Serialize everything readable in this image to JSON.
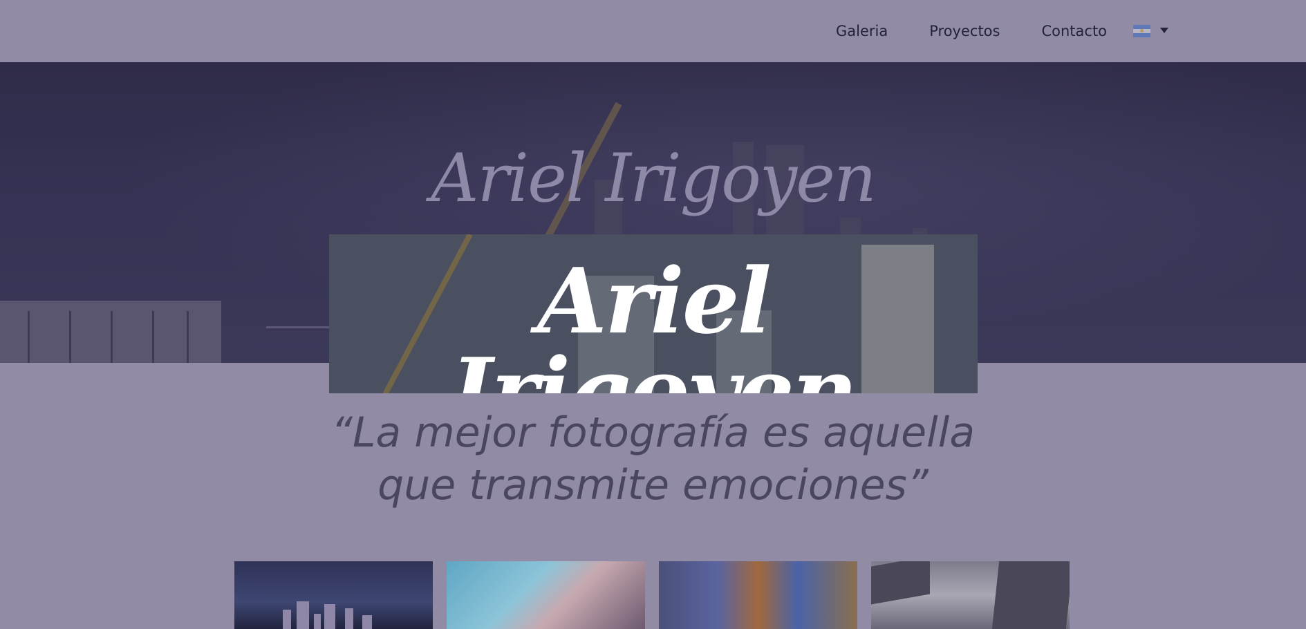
{
  "nav": {
    "items": [
      "Galeria",
      "Proyectos",
      "Contacto"
    ],
    "language": {
      "flag": "argentina-flag-icon",
      "caret": "caret-down-icon"
    }
  },
  "hero": {
    "title": "Ariel Irigoyen"
  },
  "logo": {
    "text": "Ariel Irigoyen"
  },
  "quote": {
    "line1": "“La mejor fotografía es aquella",
    "line2": "que transmite emociones”"
  },
  "gallery": {
    "count": 4
  },
  "colors": {
    "page_bg": "#918ba6",
    "hero_bg": "#353253",
    "nav_text": "#24223a",
    "quote_text": "#4a4560"
  }
}
